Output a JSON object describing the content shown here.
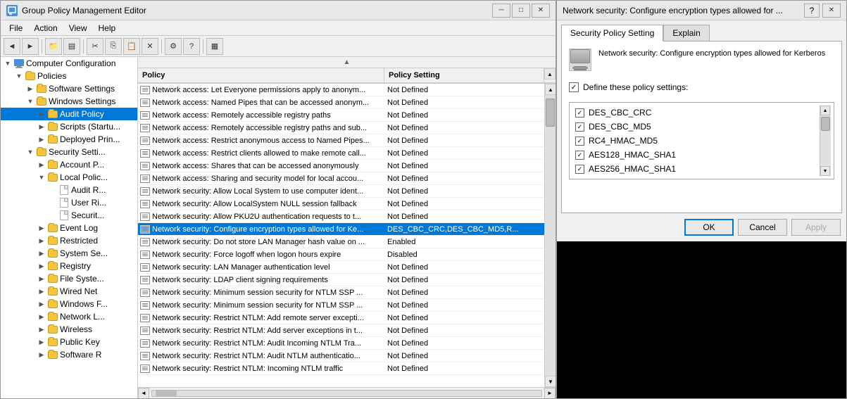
{
  "gpm": {
    "title": "Group Policy Management Editor",
    "menu": [
      "File",
      "Action",
      "View",
      "Help"
    ],
    "toolbar_buttons": [
      "back",
      "forward",
      "up",
      "show-hide",
      "cut",
      "copy",
      "paste",
      "delete",
      "properties",
      "help",
      "view"
    ],
    "tree": {
      "root": "Computer Configuration",
      "nodes": [
        {
          "id": "computer-config",
          "label": "Computer Configuration",
          "level": 0,
          "expanded": true,
          "icon": "computer"
        },
        {
          "id": "policies",
          "label": "Policies",
          "level": 1,
          "expanded": true,
          "icon": "folder"
        },
        {
          "id": "software-settings",
          "label": "Software Settings",
          "level": 2,
          "expanded": false,
          "icon": "folder"
        },
        {
          "id": "windows-settings",
          "label": "Windows Settings",
          "level": 2,
          "expanded": true,
          "icon": "folder"
        },
        {
          "id": "audit-policy",
          "label": "Audit Policy",
          "level": 3,
          "expanded": false,
          "icon": "folder",
          "selected": true
        },
        {
          "id": "scripts",
          "label": "Scripts (Startu...",
          "level": 3,
          "expanded": false,
          "icon": "folder"
        },
        {
          "id": "deployed-printers",
          "label": "Deployed Prin...",
          "level": 3,
          "expanded": false,
          "icon": "folder"
        },
        {
          "id": "security-settings",
          "label": "Security Setti...",
          "level": 2,
          "expanded": true,
          "icon": "folder"
        },
        {
          "id": "account-policies",
          "label": "Account P...",
          "level": 3,
          "expanded": false,
          "icon": "folder"
        },
        {
          "id": "local-policies",
          "label": "Local Polic...",
          "level": 3,
          "expanded": true,
          "icon": "folder"
        },
        {
          "id": "audit-r",
          "label": "Audit R...",
          "level": 4,
          "expanded": false,
          "icon": "doc"
        },
        {
          "id": "user-rights",
          "label": "User Ri...",
          "level": 4,
          "expanded": false,
          "icon": "doc"
        },
        {
          "id": "security-options",
          "label": "Securit...",
          "level": 4,
          "expanded": false,
          "icon": "doc"
        },
        {
          "id": "event-log",
          "label": "Event Log",
          "level": 3,
          "expanded": false,
          "icon": "folder"
        },
        {
          "id": "restricted-groups",
          "label": "Restricted",
          "level": 3,
          "expanded": false,
          "icon": "folder"
        },
        {
          "id": "system-services",
          "label": "System Se...",
          "level": 3,
          "expanded": false,
          "icon": "folder"
        },
        {
          "id": "registry",
          "label": "Registry",
          "level": 3,
          "expanded": false,
          "icon": "folder"
        },
        {
          "id": "file-system",
          "label": "File Syste...",
          "level": 3,
          "expanded": false,
          "icon": "folder"
        },
        {
          "id": "wired-network",
          "label": "Wired Net",
          "level": 3,
          "expanded": false,
          "icon": "folder"
        },
        {
          "id": "windows-firewall",
          "label": "Windows F...",
          "level": 3,
          "expanded": false,
          "icon": "folder"
        },
        {
          "id": "network-list",
          "label": "Network L...",
          "level": 3,
          "expanded": false,
          "icon": "folder"
        },
        {
          "id": "wireless-network",
          "label": "Wireless",
          "level": 3,
          "expanded": false,
          "icon": "folder"
        },
        {
          "id": "public-key",
          "label": "Public Key",
          "level": 3,
          "expanded": false,
          "icon": "folder"
        },
        {
          "id": "software-restriction",
          "label": "Software R",
          "level": 3,
          "expanded": false,
          "icon": "folder"
        }
      ]
    },
    "list": {
      "headers": [
        "Policy",
        "Policy Setting"
      ],
      "rows": [
        {
          "policy": "Network access: Let Everyone permissions apply to anonym...",
          "setting": "Not Defined"
        },
        {
          "policy": "Network access: Named Pipes that can be accessed anonym...",
          "setting": "Not Defined"
        },
        {
          "policy": "Network access: Remotely accessible registry paths",
          "setting": "Not Defined"
        },
        {
          "policy": "Network access: Remotely accessible registry paths and sub...",
          "setting": "Not Defined"
        },
        {
          "policy": "Network access: Restrict anonymous access to Named Pipes...",
          "setting": "Not Defined"
        },
        {
          "policy": "Network access: Restrict clients allowed to make remote call...",
          "setting": "Not Defined"
        },
        {
          "policy": "Network access: Shares that can be accessed anonymously",
          "setting": "Not Defined"
        },
        {
          "policy": "Network access: Sharing and security model for local accou...",
          "setting": "Not Defined"
        },
        {
          "policy": "Network security: Allow Local System to use computer ident...",
          "setting": "Not Defined"
        },
        {
          "policy": "Network security: Allow LocalSystem NULL session fallback",
          "setting": "Not Defined"
        },
        {
          "policy": "Network security: Allow PKU2U authentication requests to t...",
          "setting": "Not Defined"
        },
        {
          "policy": "Network security: Configure encryption types allowed for Ke...",
          "setting": "DES_CBC_CRC,DES_CBC_MD5,R...",
          "selected": true
        },
        {
          "policy": "Network security: Do not store LAN Manager hash value on ...",
          "setting": "Enabled"
        },
        {
          "policy": "Network security: Force logoff when logon hours expire",
          "setting": "Disabled"
        },
        {
          "policy": "Network security: LAN Manager authentication level",
          "setting": "Not Defined"
        },
        {
          "policy": "Network security: LDAP client signing requirements",
          "setting": "Not Defined"
        },
        {
          "policy": "Network security: Minimum session security for NTLM SSP ...",
          "setting": "Not Defined"
        },
        {
          "policy": "Network security: Minimum session security for NTLM SSP ...",
          "setting": "Not Defined"
        },
        {
          "policy": "Network security: Restrict NTLM: Add remote server excepti...",
          "setting": "Not Defined"
        },
        {
          "policy": "Network security: Restrict NTLM: Add server exceptions in t...",
          "setting": "Not Defined"
        },
        {
          "policy": "Network security: Restrict NTLM: Audit Incoming NTLM Tra...",
          "setting": "Not Defined"
        },
        {
          "policy": "Network security: Restrict NTLM: Audit NTLM authenticatio...",
          "setting": "Not Defined"
        },
        {
          "policy": "Network security: Restrict NTLM: Incoming NTLM traffic",
          "setting": "Not Defined"
        }
      ]
    }
  },
  "dialog": {
    "title": "Network security: Configure encryption types allowed for ...",
    "tabs": [
      "Security Policy Setting",
      "Explain"
    ],
    "active_tab": "Security Policy Setting",
    "policy_description": "Network security: Configure encryption types allowed for Kerberos",
    "define_label": "Define these policy settings:",
    "define_checked": true,
    "encryption_items": [
      {
        "label": "DES_CBC_CRC",
        "checked": true
      },
      {
        "label": "DES_CBC_MD5",
        "checked": true
      },
      {
        "label": "RC4_HMAC_MD5",
        "checked": true
      },
      {
        "label": "AES128_HMAC_SHA1",
        "checked": true
      },
      {
        "label": "AES256_HMAC_SHA1",
        "checked": true
      }
    ],
    "buttons": {
      "ok": "OK",
      "cancel": "Cancel",
      "apply": "Apply"
    }
  }
}
